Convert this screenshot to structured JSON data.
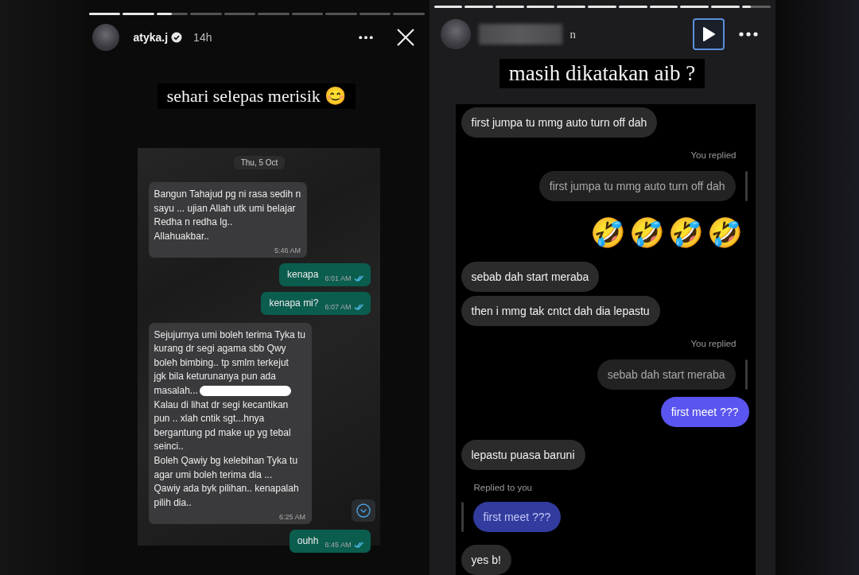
{
  "story_left": {
    "segments": [
      {
        "kind": "seen"
      },
      {
        "kind": "seen"
      },
      {
        "kind": "current",
        "level": 0.5
      },
      {
        "kind": "unseen"
      },
      {
        "kind": "unseen"
      },
      {
        "kind": "unseen"
      },
      {
        "kind": "unseen"
      },
      {
        "kind": "unseen"
      },
      {
        "kind": "unseen"
      },
      {
        "kind": "unseen"
      }
    ],
    "header": {
      "username": "atyka.j",
      "verified": true,
      "time": "14h"
    },
    "caption": "sehari selepas merisik 😊",
    "chat": {
      "date": "Thu, 5 Oct",
      "messages": [
        {
          "kind": "incoming",
          "lines": [
            {
              "text": "Bangun Tahajud pg ni rasa sedih n",
              "redacted": false
            },
            {
              "text": "sayu ... ujian Allah utk umi belajar",
              "redacted": false
            },
            {
              "text": "Redha n redha lg..",
              "redacted": false
            },
            {
              "text": "Allahuakbar..",
              "redacted": false
            }
          ],
          "time": "5:46 AM"
        },
        {
          "kind": "outgoing",
          "lines": [
            {
              "text": "kenapa",
              "redacted": false
            }
          ],
          "time": "6:01 AM",
          "read": true
        },
        {
          "kind": "outgoing",
          "lines": [
            {
              "text": "kenapa mi?",
              "redacted": false
            }
          ],
          "time": "6:07 AM",
          "read": true
        },
        {
          "kind": "incoming",
          "lines": [
            {
              "text": "Sejujurnya umi boleh terima Tyka tu",
              "redacted": false
            },
            {
              "text": "kurang dr segi agama sbb Qwy",
              "redacted": false
            },
            {
              "text": "boleh bimbing.. tp smlm terkejut",
              "redacted": false
            },
            {
              "text": "jgk bila keturunanya pun ada",
              "redacted": false
            },
            {
              "text": "masalah...",
              "redacted": true
            },
            {
              "text": "Kalau di lihat dr segi kecantikan",
              "redacted": false
            },
            {
              "text": "pun .. xlah cntik sgt...hnya",
              "redacted": false
            },
            {
              "text": "bergantung pd make up yg tebal",
              "redacted": false
            },
            {
              "text": "seinci..",
              "redacted": false
            },
            {
              "text": "Boleh Qawiy bg kelebihan Tyka tu",
              "redacted": false
            },
            {
              "text": "agar umi boleh terima dia ...",
              "redacted": false
            },
            {
              "text": "Qawiy ada byk pilihan.. kenapalah",
              "redacted": false
            },
            {
              "text": "pilih dia..",
              "redacted": false
            }
          ],
          "time": "6:25 AM"
        },
        {
          "kind": "outgoing",
          "lines": [
            {
              "text": "ouhh",
              "redacted": false
            }
          ],
          "time": "6:45 AM",
          "read": true
        }
      ]
    }
  },
  "story_right": {
    "segments": [
      {
        "kind": "seen"
      },
      {
        "kind": "seen"
      },
      {
        "kind": "seen"
      },
      {
        "kind": "seen"
      },
      {
        "kind": "seen"
      },
      {
        "kind": "seen"
      },
      {
        "kind": "seen"
      },
      {
        "kind": "seen"
      },
      {
        "kind": "seen"
      },
      {
        "kind": "seen"
      },
      {
        "kind": "current",
        "level": 0.3
      }
    ],
    "header": {
      "username": "n",
      "username_blurred": true,
      "play_focused": true
    },
    "caption": "masih dikatakan aib ?",
    "messages": [
      {
        "kind": "incoming",
        "text": "first jumpa tu mmg auto turn off dah"
      },
      {
        "kind": "label_right",
        "text": "You replied"
      },
      {
        "kind": "quote_right",
        "text": "first jumpa tu mmg auto turn off dah"
      },
      {
        "kind": "emoji",
        "text": "🤣🤣🤣🤣"
      },
      {
        "kind": "incoming",
        "text": "sebab dah start meraba"
      },
      {
        "kind": "incoming",
        "text": "then i mmg tak cntct dah dia lepastu"
      },
      {
        "kind": "label_right",
        "text": "You replied"
      },
      {
        "kind": "quote_right",
        "text": "sebab dah start meraba"
      },
      {
        "kind": "outgoing",
        "text": "first meet ???"
      },
      {
        "kind": "incoming",
        "text": "lepastu puasa baruni"
      },
      {
        "kind": "label_left",
        "text": "Replied to you"
      },
      {
        "kind": "quote_left",
        "text": "first meet ???"
      },
      {
        "kind": "incoming",
        "text": "yes b!"
      }
    ]
  }
}
